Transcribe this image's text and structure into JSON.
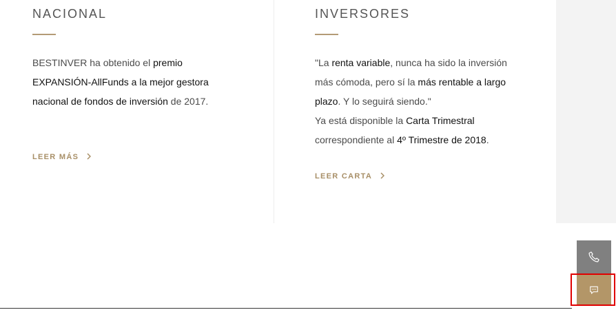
{
  "left": {
    "heading": "NACIONAL",
    "lines": [
      [
        {
          "t": "BESTINVER ha obtenido el ",
          "b": false
        },
        {
          "t": "premio",
          "b": true
        }
      ],
      [
        {
          "t": "EXPANSIÓN-AllFunds a la mejor gestora",
          "b": true
        }
      ],
      [
        {
          "t": "nacional de fondos de inversión",
          "b": true
        },
        {
          "t": " de 2017.",
          "b": false
        }
      ]
    ],
    "link": "LEER MÁS"
  },
  "right": {
    "heading": "INVERSORES",
    "lines": [
      [
        {
          "t": "\"La ",
          "b": false
        },
        {
          "t": "renta variable",
          "b": true
        },
        {
          "t": ", nunca ha sido la inversión",
          "b": false
        }
      ],
      [
        {
          "t": "más cómoda, pero sí la ",
          "b": false
        },
        {
          "t": "más rentable a largo",
          "b": true
        }
      ],
      [
        {
          "t": "plazo",
          "b": true
        },
        {
          "t": ". Y lo seguirá siendo.\"",
          "b": false
        }
      ],
      [
        {
          "t": "Ya está disponible la ",
          "b": false
        },
        {
          "t": "Carta Trimestral",
          "b": true
        }
      ],
      [
        {
          "t": "correspondiente al ",
          "b": false
        },
        {
          "t": "4º Trimestre de 2018",
          "b": true
        },
        {
          "t": ".",
          "b": false
        }
      ]
    ],
    "link": "LEER CARTA"
  },
  "side": {
    "phone_icon": "phone-icon",
    "chat_icon": "chat-icon"
  },
  "colors": {
    "accent": "#b39b76",
    "link": "#a88f67",
    "phone_bg": "#808080",
    "chat_bg": "#b39668",
    "highlight": "#e00000"
  }
}
